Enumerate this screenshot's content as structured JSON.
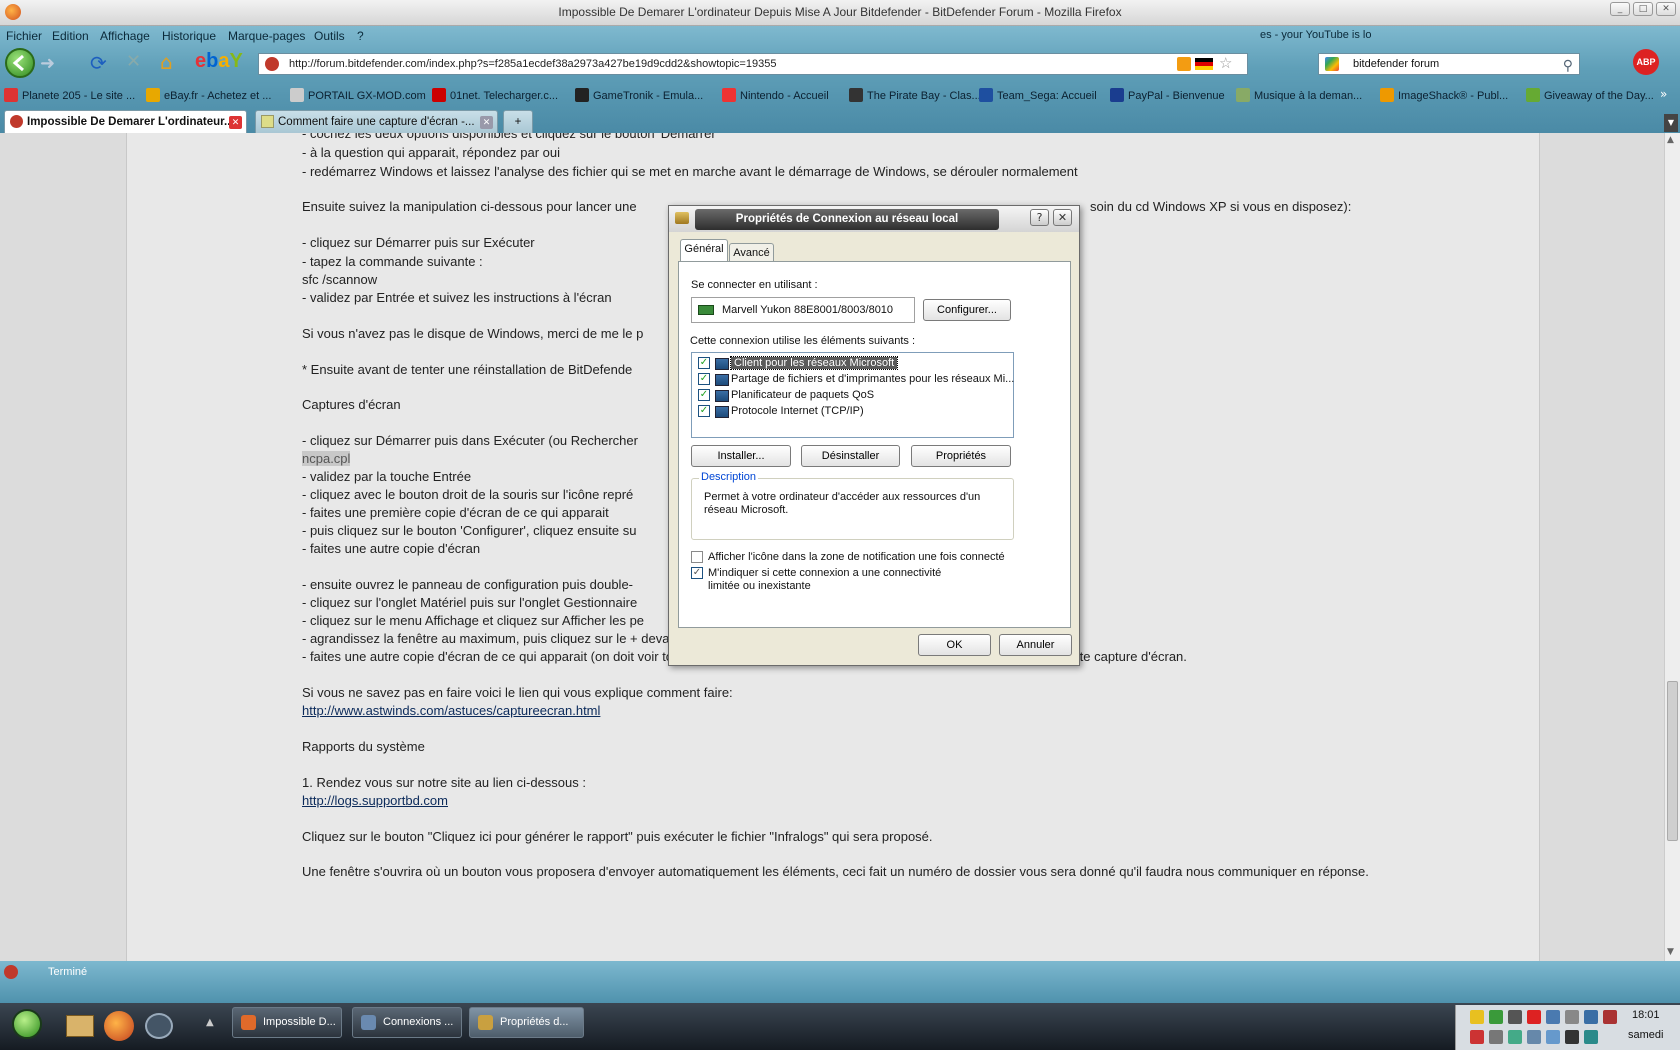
{
  "window": {
    "title": "Impossible De Demarer L'ordinateur Depuis Mise A Jour Bitdefender - BitDefender Forum - Mozilla Firefox"
  },
  "menu": [
    "Fichier",
    "Edition",
    "Affichage",
    "Historique",
    "Marque-pages",
    "Outils",
    "?"
  ],
  "toolbar": {
    "url": "http://forum.bitdefender.com/index.php?s=f285a1ecdef38a2973a427be19d9cdd2&showtopic=19355",
    "search_value": "bitdefender forum",
    "youtube_ticker": "es - your YouTube is lo",
    "abp": "ABP"
  },
  "bookmarks": [
    {
      "label": "Planete 205 - Le site ...",
      "color": "#d33"
    },
    {
      "label": "eBay.fr - Achetez et ...",
      "color": "#e8a800"
    },
    {
      "label": "PORTAIL GX-MOD.com",
      "color": "#ccc"
    },
    {
      "label": "01net. Telecharger.c...",
      "color": "#c00"
    },
    {
      "label": "GameTronik - Emula...",
      "color": "#222"
    },
    {
      "label": "Nintendo - Accueil",
      "color": "#e33"
    },
    {
      "label": "The Pirate Bay - Clas...",
      "color": "#333"
    },
    {
      "label": "Team_Sega: Accueil",
      "color": "#1e4fa0"
    },
    {
      "label": "PayPal - Bienvenue",
      "color": "#1a3d8f"
    },
    {
      "label": "Musique à la deman...",
      "color": "#8a6"
    },
    {
      "label": "ImageShack® - Publ...",
      "color": "#e90"
    },
    {
      "label": "Giveaway of the Day...",
      "color": "#6a3"
    }
  ],
  "tabs": [
    {
      "label": "Impossible De Demarer L'ordinateur...",
      "active": true
    },
    {
      "label": "Comment faire une capture d'écran -...",
      "active": false
    }
  ],
  "content": {
    "lines": [
      "- cochez les deux options disponibles et cliquez sur le bouton 'Démarrer'",
      "- à la question qui apparait, répondez par oui",
      "- redémarrez Windows et laissez l'analyse des fichier qui se met en marche avant le démarrage de Windows, se dérouler normalement",
      "Ensuite suivez la manipulation ci-dessous pour lancer une",
      "soin du cd Windows XP si vous en disposez):",
      "- cliquez sur Démarrer puis sur Exécuter",
      "- tapez la commande suivante :",
      "sfc /scannow",
      "- validez par Entrée et suivez les instructions à l'écran",
      "Si vous n'avez pas le disque de Windows, merci de me le p",
      "* Ensuite avant de tenter une réinstallation de BitDefende",
      "Captures d'écran",
      "- cliquez sur Démarrer puis dans Exécuter (ou Rechercher",
      "ncpa.cpl",
      "- validez par la touche Entrée",
      "- cliquez avec le bouton droit de la souris sur l'icône repré",
      "- faites une première copie d'écran de ce qui apparait",
      "- puis cliquez sur le bouton 'Configurer', cliquez ensuite su",
      "- faites une autre copie d'écran",
      "- ensuite ouvrez le panneau de configuration puis double-",
      "- cliquez sur l'onglet Matériel puis sur l'onglet Gestionnaire",
      "- cliquez sur le menu Affichage et cliquez sur Afficher les pe",
      "- agrandissez la fenêtre au maximum, puis cliquez sur le + devant 'Pilotes non plud and play'",
      "- faites une autre copie d'écran de ce qui apparait (on doit voir tous les pilotes non plug and play, toute la liste) et faites moi parvenir cette capture d'écran.",
      "Si vous ne savez pas en faire voici le lien qui vous explique comment faire:",
      "http://www.astwinds.com/astuces/captureecran.html",
      "Rapports du système",
      "1. Rendez vous sur notre site au lien ci-dessous :",
      "http://logs.supportbd.com",
      "Cliquez sur le bouton \"Cliquez ici pour générer le rapport\" puis exécuter le fichier \"Infralogs\" qui sera proposé.",
      "Une fenêtre s'ouvrira où un bouton vous proposera d'envoyer automatiquement les éléments, ceci fait un numéro de dossier vous sera donné qu'il faudra nous communiquer en réponse."
    ]
  },
  "dialog": {
    "title": "Propriétés de Connexion au réseau local",
    "tabs": [
      "Général",
      "Avancé"
    ],
    "connect_label": "Se connecter en utilisant :",
    "adapter": "Marvell Yukon 88E8001/8003/8010",
    "configure": "Configurer...",
    "items_label": "Cette connexion utilise les éléments suivants :",
    "items": [
      "Client pour les réseaux Microsoft",
      "Partage de fichiers et d'imprimantes pour les réseaux Mi...",
      "Planificateur de paquets QoS",
      "Protocole Internet (TCP/IP)"
    ],
    "install": "Installer...",
    "uninstall": "Désinstaller",
    "properties": "Propriétés",
    "description_title": "Description",
    "description": "Permet à votre ordinateur d'accéder aux ressources d'un réseau Microsoft.",
    "opt1": "Afficher l'icône dans la zone de notification une fois connecté",
    "opt2": "M'indiquer si cette connexion a une connectivité limitée ou inexistante",
    "ok": "OK",
    "cancel": "Annuler"
  },
  "status": {
    "text": "Terminé"
  },
  "taskbar": {
    "items": [
      "Impossible D...",
      "Connexions ...",
      "Propriétés d..."
    ],
    "time": "18:01",
    "day": "samedi"
  }
}
